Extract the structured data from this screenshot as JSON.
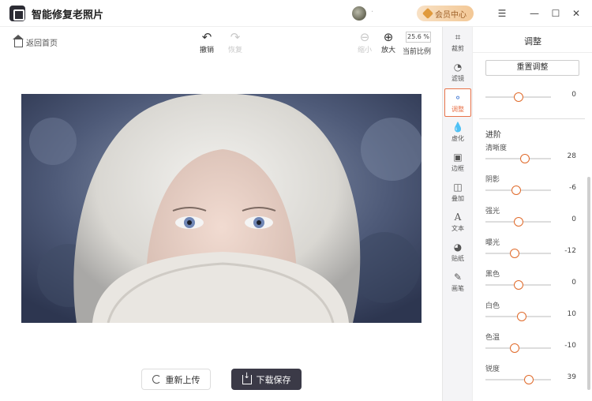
{
  "app": {
    "title": "智能修复老照片",
    "user_name": "·",
    "vip_label": "会员中心"
  },
  "window": {
    "menu_icon": "menu-icon",
    "min_icon": "minimize-icon",
    "max_icon": "maximize-icon",
    "close_icon": "close-icon"
  },
  "toolbar": {
    "back_home": "返回首页",
    "undo": "撤销",
    "redo": "恢复",
    "zoom_out": "缩小",
    "zoom_in": "放大",
    "zoom_value": "25.6 %",
    "zoom_label": "当前比例"
  },
  "tools": [
    {
      "label": "裁剪",
      "icon": "crop-icon",
      "active": false
    },
    {
      "label": "滤镜",
      "icon": "filter-icon",
      "active": false
    },
    {
      "label": "调整",
      "icon": "adjust-icon",
      "active": true
    },
    {
      "label": "虚化",
      "icon": "blur-icon",
      "active": false
    },
    {
      "label": "边框",
      "icon": "frame-icon",
      "active": false
    },
    {
      "label": "叠加",
      "icon": "overlay-icon",
      "active": false
    },
    {
      "label": "文本",
      "icon": "text-icon",
      "active": false
    },
    {
      "label": "贴纸",
      "icon": "sticker-icon",
      "active": false
    },
    {
      "label": "画笔",
      "icon": "brush-icon",
      "active": false
    }
  ],
  "panel": {
    "title": "调整",
    "reset_label": "重置调整",
    "top_slider_value": "0",
    "section_title": "进阶",
    "sliders": [
      {
        "label": "清晰度",
        "value": "28",
        "fraction": 0.6
      },
      {
        "label": "阴影",
        "value": "-6",
        "fraction": 0.47
      },
      {
        "label": "强光",
        "value": "0",
        "fraction": 0.5
      },
      {
        "label": "曝光",
        "value": "-12",
        "fraction": 0.44
      },
      {
        "label": "黑色",
        "value": "0",
        "fraction": 0.5
      },
      {
        "label": "白色",
        "value": "10",
        "fraction": 0.55
      },
      {
        "label": "色温",
        "value": "-10",
        "fraction": 0.45
      },
      {
        "label": "锐度",
        "value": "39",
        "fraction": 0.66
      }
    ]
  },
  "bottom": {
    "reupload": "重新上传",
    "download": "下载保存"
  },
  "colors": {
    "accent": "#e8734a",
    "dark_button": "#3b3a47",
    "vip_bg": "#f3c896"
  }
}
